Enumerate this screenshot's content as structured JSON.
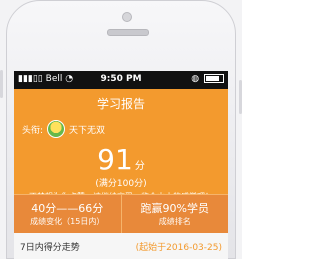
{
  "status": {
    "carrier": "Bell",
    "time": "9:50 PM",
    "battery_level": 0.8
  },
  "header": {
    "title": "学习报告"
  },
  "profile": {
    "label": "头衔:",
    "title": "天下无双"
  },
  "score": {
    "value": "91",
    "unit": "分",
    "full": "(满分100分)",
    "message": "不禁想为你点赞，请继续享受一览众山小的感觉吧！"
  },
  "stats": {
    "range_value": "40分——66分",
    "range_label": "成绩变化（15日内）",
    "rank_value": "跑赢90%学员",
    "rank_label": "成绩排名"
  },
  "trend": {
    "title": "7日内得分走势",
    "since": "(起始于2016-03-25)"
  },
  "colors": {
    "brand_orange": "#f39a2e",
    "stats_orange": "#e8893a"
  }
}
